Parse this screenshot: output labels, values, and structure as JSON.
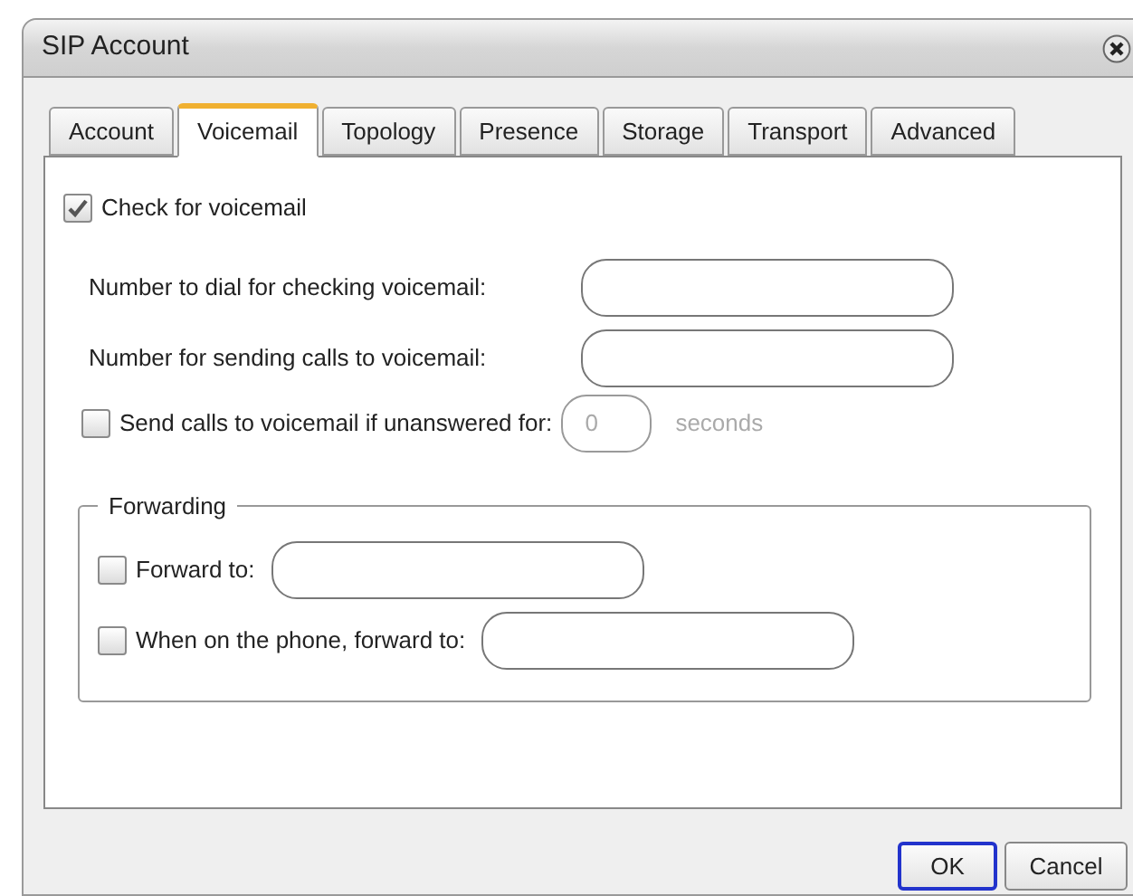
{
  "window": {
    "title": "SIP Account"
  },
  "tabs": [
    {
      "label": "Account",
      "selected": false
    },
    {
      "label": "Voicemail",
      "selected": true
    },
    {
      "label": "Topology",
      "selected": false
    },
    {
      "label": "Presence",
      "selected": false
    },
    {
      "label": "Storage",
      "selected": false
    },
    {
      "label": "Transport",
      "selected": false
    },
    {
      "label": "Advanced",
      "selected": false
    }
  ],
  "check_voicemail": {
    "label": "Check for voicemail",
    "checked": true
  },
  "fields": [
    {
      "label": "Number to dial for checking voicemail:"
    },
    {
      "label": "Number for sending calls to voicemail:"
    }
  ],
  "unanswered": {
    "label": "Send calls to voicemail if unanswered for:",
    "checked": false,
    "value": "0",
    "unit": "seconds",
    "disabled": true
  },
  "forwarding": {
    "title": "Forwarding",
    "rows": [
      {
        "label": "Forward to:",
        "checked": false
      },
      {
        "label": "When on the phone, forward to:",
        "checked": false
      }
    ]
  },
  "buttons": [
    {
      "label": "OK",
      "selected": true
    },
    {
      "label": "Cancel",
      "selected": false
    }
  ]
}
